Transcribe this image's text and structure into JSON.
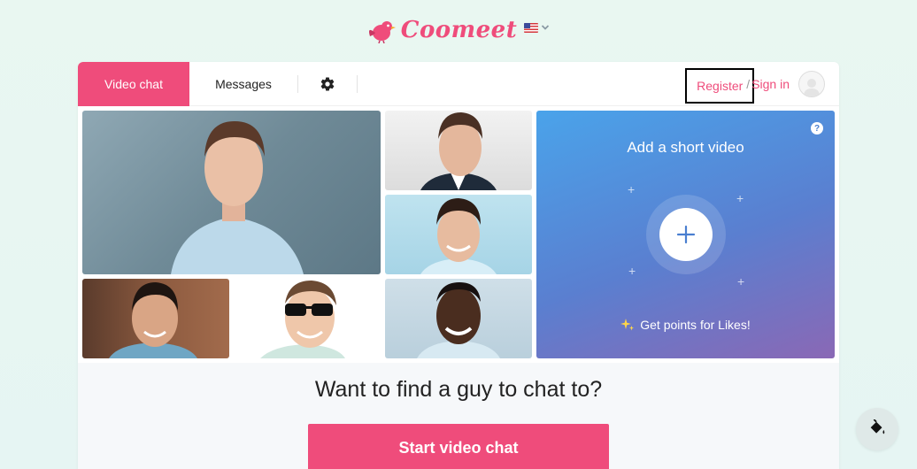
{
  "brand": {
    "name": "Coomeet",
    "accent": "#ef4c7b"
  },
  "language": {
    "selected_icon": "us-flag-icon"
  },
  "nav": {
    "tabs": [
      {
        "label": "Video chat",
        "active": true
      },
      {
        "label": "Messages",
        "active": false
      }
    ],
    "settings_icon": "gear-icon"
  },
  "auth": {
    "register": "Register",
    "separator": "/",
    "signin": "Sign in"
  },
  "video_panel": {
    "title": "Add a short video",
    "help": "?",
    "points_text": "Get points for Likes!"
  },
  "cta": {
    "title": "Want to find a guy to chat to?",
    "button": "Start video chat"
  },
  "fab": {
    "icon": "paint-bucket-icon"
  }
}
